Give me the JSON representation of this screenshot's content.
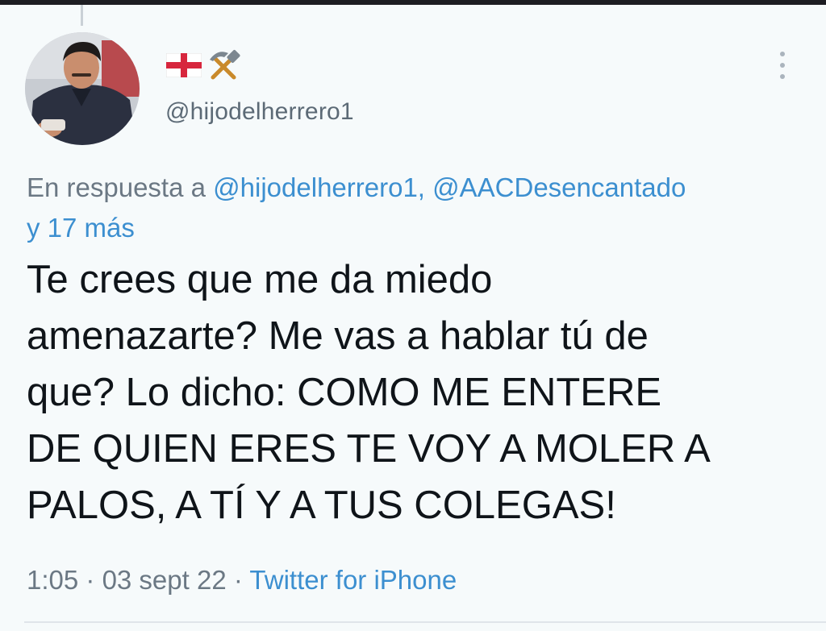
{
  "tweet": {
    "display_name_icons": [
      "england-flag-icon",
      "hammer-and-pick-icon"
    ],
    "handle": "@hijodelherrero1",
    "reply_prefix": "En respuesta a ",
    "reply_mention_1": "@hijodelherrero1",
    "reply_separator": ", ",
    "reply_mention_2": "@AACDesencantado",
    "reply_more": "y 17 más",
    "text": "Te crees que me da miedo\namenazarte? Me vas a hablar tú de\nque? Lo dicho: COMO ME ENTERE\nDE QUIEN ERES TE VOY A MOLER A\nPALOS, A TÍ Y A TUS COLEGAS!",
    "time": "1:05",
    "dot_1": " · ",
    "date": "03 sept 22",
    "dot_2": " · ",
    "source": "Twitter for iPhone"
  },
  "colors": {
    "background": "#f6fafb",
    "link": "#3c8fd0",
    "secondary_text": "#6b7884",
    "primary_text": "#0f1419"
  }
}
